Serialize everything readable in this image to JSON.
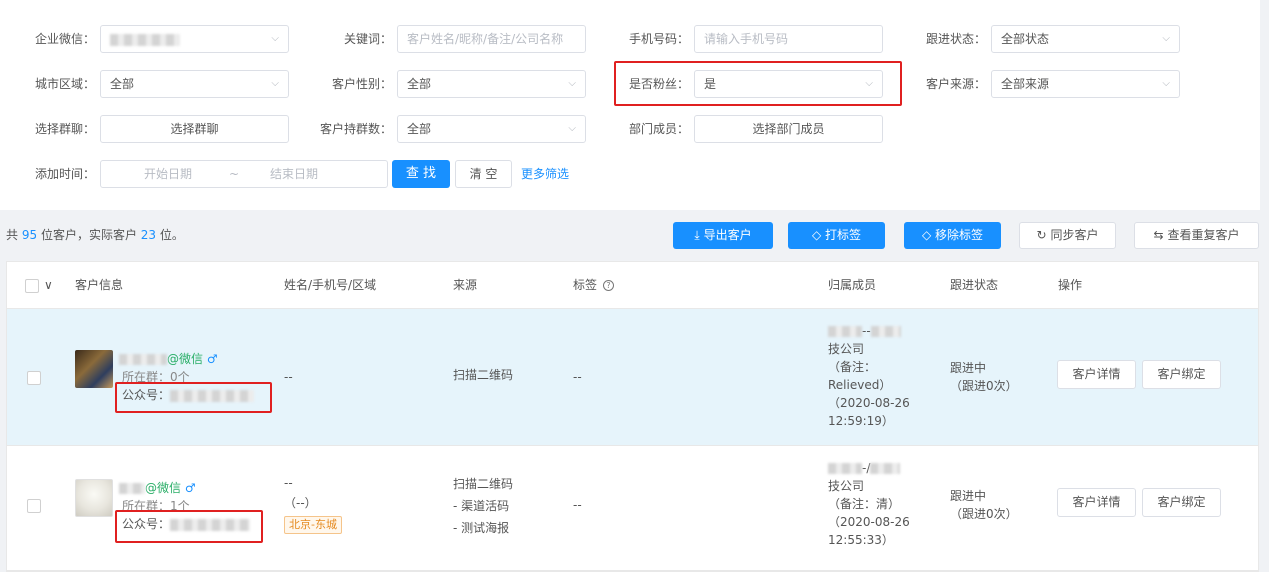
{
  "filters": {
    "corp_wechat_label": "企业微信：",
    "keyword_label": "关键词：",
    "keyword_placeholder": "客户姓名/昵称/备注/公司名称",
    "phone_label": "手机号码：",
    "phone_placeholder": "请输入手机号码",
    "follow_status_label": "跟进状态：",
    "follow_status_value": "全部状态",
    "city_label": "城市区域：",
    "city_value": "全部",
    "gender_label": "客户性别：",
    "gender_value": "全部",
    "is_fan_label": "是否粉丝：",
    "is_fan_value": "是",
    "source_label": "客户来源：",
    "source_value": "全部来源",
    "group_chat_label": "选择群聊：",
    "group_chat_button": "选择群聊",
    "group_count_label": "客户持群数：",
    "group_count_value": "全部",
    "dept_member_label": "部门成员：",
    "dept_member_button": "选择部门成员",
    "add_time_label": "添加时间：",
    "start_date_placeholder": "开始日期",
    "date_separator": "~",
    "end_date_placeholder": "结束日期",
    "search_button": "查 找",
    "clear_button": "清 空",
    "more_filters_link": "更多筛选"
  },
  "summary": {
    "prefix": "共",
    "total": "95",
    "mid": "位客户，实际客户",
    "actual": "23",
    "suffix": "位。"
  },
  "toolbar": {
    "export_label": "导出客户",
    "tag_label": "打标签",
    "remove_tag_label": "移除标签",
    "sync_label": "同步客户",
    "duplicate_label": "查看重复客户"
  },
  "table": {
    "headers": {
      "info": "客户信息",
      "name_phone_area": "姓名/手机号/区域",
      "source": "来源",
      "tags": "标签",
      "owner": "归属成员",
      "follow_status": "跟进状态",
      "actions": "操作"
    },
    "help_icon_text": "?",
    "rows": [
      {
        "wechat_suffix": "@微信",
        "gender_symbol": "♂",
        "groups": "所在群：0个",
        "official_account": "公众号：",
        "name_phone_area": "--",
        "source_lines": [
          "扫描二维码"
        ],
        "tags": "--",
        "owner_sep": "--",
        "owner_company": "技公司",
        "owner_note_open": "（备注：",
        "owner_note": "Relieved）",
        "owner_time_1": "（2020-08-26",
        "owner_time_2": "12:59:19）",
        "status": "跟进中",
        "status_count": "（跟进0次）",
        "detail_button": "客户详情",
        "bind_button": "客户绑定"
      },
      {
        "wechat_suffix": "@微信",
        "gender_symbol": "♂",
        "groups": "所在群：1个",
        "official_account": "公众号：",
        "name": "--",
        "phone": "（--）",
        "area_tag": "北京-东城",
        "source_lines": [
          "扫描二维码",
          "- 渠道活码",
          "- 测试海报"
        ],
        "tags": "--",
        "owner_sep": "-/",
        "owner_company": "技公司",
        "owner_note_open": "（备注：清）",
        "owner_time_1": "（2020-08-26",
        "owner_time_2": "12:55:33）",
        "status": "跟进中",
        "status_count": "（跟进0次）",
        "detail_button": "客户详情",
        "bind_button": "客户绑定"
      }
    ]
  },
  "icons": {
    "chevron": "⌵",
    "download": "⤓",
    "tag": "◇",
    "sync": "↻",
    "swap": "⇆",
    "select_all_chevron": "∨"
  }
}
